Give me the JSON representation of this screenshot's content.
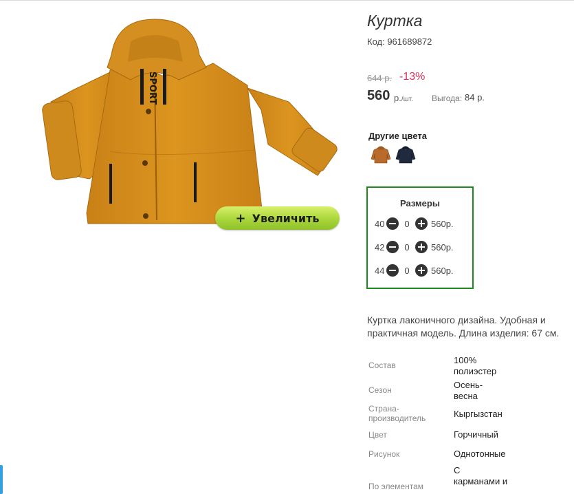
{
  "product": {
    "title": "Куртка",
    "code": "Код: 961689872",
    "old_price": "644 р.",
    "discount": "-13%",
    "price": "560",
    "price_unit": "р.",
    "price_unit_per": "/шт.",
    "savings_label": "Выгода:",
    "savings_value": "84 р.",
    "image_print_text": "SPORT"
  },
  "zoom_button": {
    "label": "Увеличить",
    "icon": "+"
  },
  "other_colors": {
    "title": "Другие цвета",
    "swatches": [
      {
        "name": "mustard-jacket",
        "color": "#b86b2a"
      },
      {
        "name": "navy-jacket",
        "color": "#1f2a3d"
      }
    ]
  },
  "sizes": {
    "title": "Размеры",
    "rows": [
      {
        "size": "40",
        "qty": "0",
        "price": "560р."
      },
      {
        "size": "42",
        "qty": "0",
        "price": "560р."
      },
      {
        "size": "44",
        "qty": "0",
        "price": "560р."
      }
    ],
    "box_color": "#1b8a1b"
  },
  "description": "Куртка лаконичного дизайна. Удобная и практичная модель. Длина изделия: 67 см.",
  "specs": [
    {
      "label": "Состав",
      "value": "100% полиэстер"
    },
    {
      "label": "Сезон",
      "value": "Осень-весна"
    },
    {
      "label": "Страна-производитель",
      "value": "Кыргызстан"
    },
    {
      "label": "Цвет",
      "value": "Горчичный"
    },
    {
      "label": "Рисунок",
      "value": "Однотонные"
    },
    {
      "label": "По элементам",
      "value": "С карманами и"
    }
  ],
  "colors": {
    "jacket": "#d08b22",
    "accent_green": "#a9d63a",
    "discount": "#e0305a"
  }
}
